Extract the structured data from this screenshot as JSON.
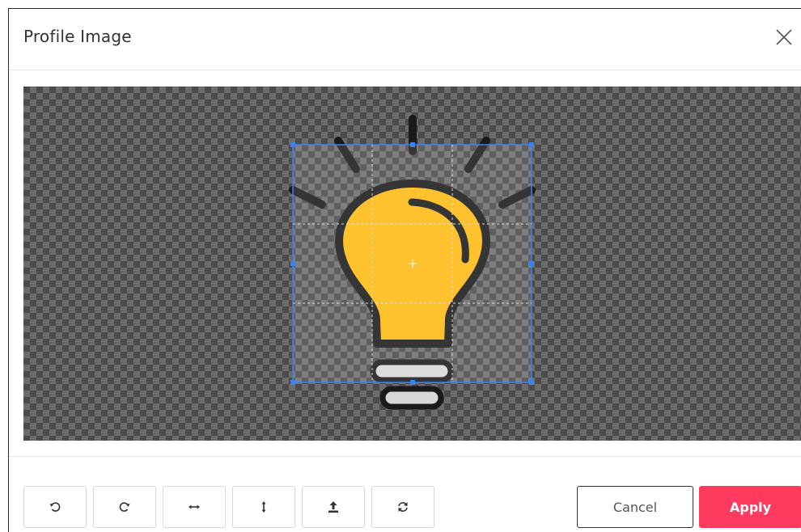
{
  "dialog": {
    "title": "Profile Image",
    "close_icon": "close-icon"
  },
  "editor": {
    "image_subject": "lightbulb",
    "bulb_color": "#FDBA12",
    "outline_color": "#1a1a1a",
    "crop_box_color": "#3b82f6"
  },
  "toolbar": {
    "tools": [
      {
        "name": "rotate-left-icon"
      },
      {
        "name": "rotate-right-icon"
      },
      {
        "name": "flip-horizontal-icon"
      },
      {
        "name": "flip-vertical-icon"
      },
      {
        "name": "upload-icon"
      },
      {
        "name": "reset-icon"
      }
    ]
  },
  "actions": {
    "cancel_label": "Cancel",
    "apply_label": "Apply",
    "apply_color": "#FE3B5F"
  }
}
